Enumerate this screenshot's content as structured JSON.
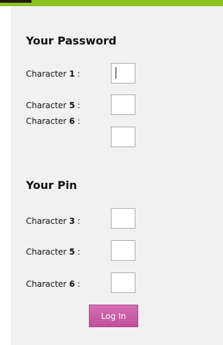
{
  "password_section": {
    "title": "Your Password",
    "rows": [
      {
        "prefix": "Character ",
        "number": "1",
        "suffix": " :",
        "value": ""
      },
      {
        "prefix": "Character ",
        "number": "5",
        "suffix": " :",
        "value": ""
      },
      {
        "prefix": "Character ",
        "number": "6",
        "suffix": " :",
        "value": ""
      }
    ]
  },
  "pin_section": {
    "title": "Your Pin",
    "rows": [
      {
        "prefix": "Character ",
        "number": "3",
        "suffix": " :",
        "value": ""
      },
      {
        "prefix": "Character ",
        "number": "5",
        "suffix": " :",
        "value": ""
      },
      {
        "prefix": "Character ",
        "number": "6",
        "suffix": " :",
        "value": ""
      }
    ]
  },
  "login_button": {
    "label": "Log In"
  },
  "colors": {
    "accent_bar": "#8dc21f",
    "panel_bg": "#f1f1f1",
    "button_bg": "#c85ea7",
    "button_text": "#ffffff"
  }
}
